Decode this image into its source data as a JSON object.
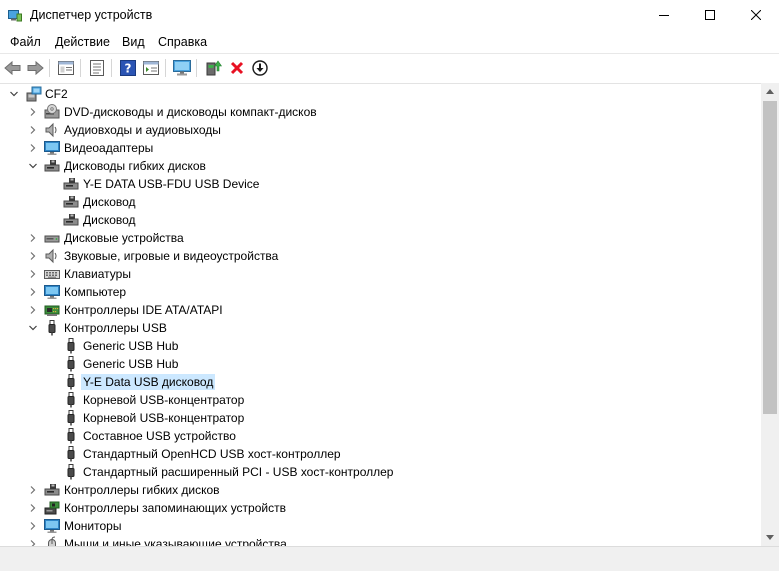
{
  "window": {
    "title": "Диспетчер устройств"
  },
  "menu": {
    "items": [
      "Файл",
      "Действие",
      "Вид",
      "Справка"
    ]
  },
  "toolbar": {
    "buttons": [
      "back",
      "forward",
      "properties-window",
      "show-hide",
      "help",
      "view-details",
      "scan-hardware",
      "update-driver",
      "uninstall-device",
      "disable-device"
    ]
  },
  "tree": {
    "root": "CF2",
    "categories": {
      "dvd": "DVD-дисководы и дисководы компакт-дисков",
      "audio_io": "Аудиовходы и аудиовыходы",
      "video": "Видеоадаптеры",
      "floppy_drives": "Дисководы гибких дисков",
      "disk_devices": "Дисковые устройства",
      "sound": "Звуковые, игровые и видеоустройства",
      "keyboards": "Клавиатуры",
      "computer": "Компьютер",
      "ide": "Контроллеры IDE ATA/ATAPI",
      "usb": "Контроллеры USB",
      "floppy_ctrl": "Контроллеры гибких дисков",
      "storage": "Контроллеры запоминающих устройств",
      "monitors": "Мониторы",
      "mice": "Мыши и иные указывающие устройства"
    },
    "floppy_children": [
      "Y-E DATA USB-FDU USB Device",
      "Дисковод",
      "Дисковод"
    ],
    "usb_children": [
      "Generic USB Hub",
      "Generic USB Hub",
      "Y-E Data USB дисковод",
      "Корневой USB-концентратор",
      "Корневой USB-концентратор",
      "Составное USB устройство",
      "Стандартный OpenHCD USB хост-контроллер",
      "Стандартный расширенный PCI - USB хост-контроллер"
    ],
    "selected": "Y-E Data USB дисковод"
  },
  "colors": {
    "selection": "#cce8ff",
    "uninstall_red": "#e81123",
    "help_blue": "#2b54b4"
  }
}
